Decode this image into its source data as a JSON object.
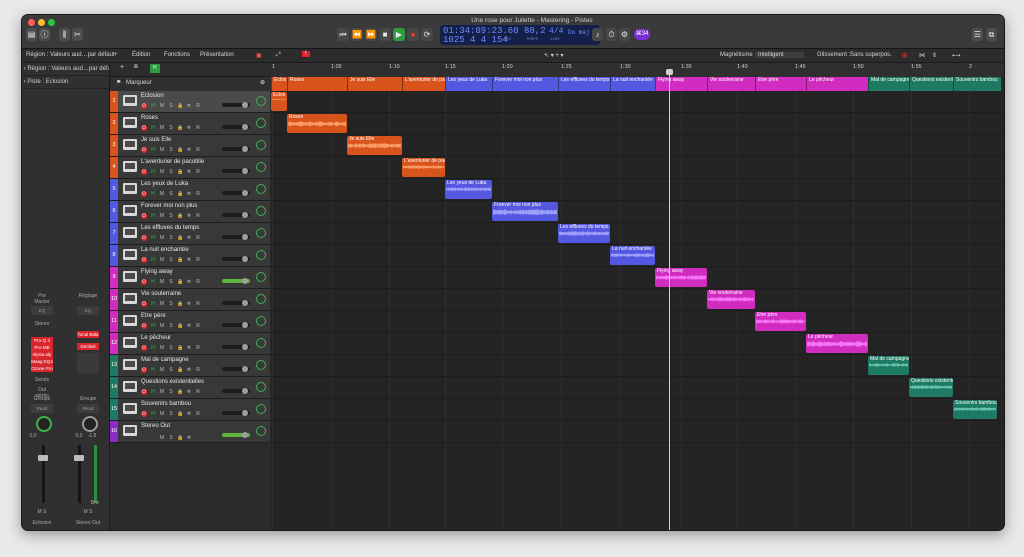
{
  "window": {
    "title": "Une rose pour Juliette - Mastering - Pistes"
  },
  "lcd": {
    "time": "01:34:09:23.60",
    "tempo": "88,2",
    "signature": "4/4",
    "key": "Do maj",
    "bars": "1025  4  4  154",
    "sub_left": "MES",
    "sub_mid": "TEMPO",
    "sub_right": "1490"
  },
  "badge": "⌘34",
  "toolbar": {
    "region_label": "Région : Valeurs aud…par défaut",
    "edition": "Édition",
    "fonctions": "Fonctions",
    "presentation": "Présentation",
    "magnetisme_label": "Magnétisme :",
    "magnetisme_value": "Intelligent",
    "glissement_label": "Glissement :",
    "glissement_value": "Sans superpos."
  },
  "inspector": {
    "piste_label": "Piste : Eclosion",
    "left_strip": {
      "setting": "Pre Master",
      "eq": "EQ",
      "stereo": "Stereo",
      "plugins": [
        "Pro-Q 3",
        "Pro-MB",
        "elysia alp",
        "Maag EQ4",
        "Ozone Pro"
      ],
      "send": "Sends",
      "out": "Out stéréo",
      "group": "Groupe",
      "auto": "Read",
      "vol": "0,0",
      "name": "Eclosion"
    },
    "right_strip": {
      "setting": "Réglage",
      "eq": "EQ",
      "plugins": [
        "Tonal Bala",
        "Decibel"
      ],
      "group": "Groupe",
      "auto": "Read",
      "vol": "0,0",
      "peak": "-1,8",
      "bnc": "Bnc",
      "name": "Stereo Out"
    },
    "ms": "M  S"
  },
  "track_header": {
    "marker_label": "Marqueur",
    "tag": "H"
  },
  "ruler": [
    "1",
    "1:05",
    "1:10",
    "1:15",
    "1:20",
    "1:25",
    "1:30",
    "1:35",
    "1:40",
    "1:45",
    "1:50",
    "1:55",
    "2"
  ],
  "markers": [
    {
      "name": "Eclos",
      "color": "#d9531c"
    },
    {
      "name": "Roses",
      "color": "#d9531c"
    },
    {
      "name": "Je suis Elle",
      "color": "#d9531c"
    },
    {
      "name": "L'aventurier de pacotille",
      "color": "#d9531c"
    },
    {
      "name": "Les yeux de Luka",
      "color": "#5457e0"
    },
    {
      "name": "Forever moi non plus",
      "color": "#5457e0"
    },
    {
      "name": "Les effluves du temps",
      "color": "#5457e0"
    },
    {
      "name": "La nuit enchantée",
      "color": "#5457e0"
    },
    {
      "name": "Flying away",
      "color": "#d12cc0"
    },
    {
      "name": "Vie souterraine",
      "color": "#d12cc0"
    },
    {
      "name": "Etre père",
      "color": "#d12cc0"
    },
    {
      "name": "Le pêcheur",
      "color": "#d12cc0"
    },
    {
      "name": "Mal de campagne",
      "color": "#1e7a63"
    },
    {
      "name": "Questions existentielles",
      "color": "#1e7a63"
    },
    {
      "name": "Souvenirs bambou",
      "color": "#1e7a63"
    }
  ],
  "tracks": [
    {
      "num": "1",
      "name": "Eclosion",
      "color": "#d9531c",
      "region": "Eclos"
    },
    {
      "num": "2",
      "name": "Roses",
      "color": "#d9531c",
      "region": "Roses"
    },
    {
      "num": "3",
      "name": "Je suis Elle",
      "color": "#d9531c",
      "region": "Je suis Elle"
    },
    {
      "num": "4",
      "name": "L'aventurier de pacotille",
      "color": "#d9531c",
      "region": "L'aventurier de pac"
    },
    {
      "num": "5",
      "name": "Les yeux de Luka",
      "color": "#5457e0",
      "region": "Les yeux de Luka"
    },
    {
      "num": "6",
      "name": "Forever moi non plus",
      "color": "#5457e0",
      "region": "Forever moi non plus"
    },
    {
      "num": "7",
      "name": "Les effluves du temps",
      "color": "#5457e0",
      "region": "Les effluves du temps"
    },
    {
      "num": "8",
      "name": "La nuit enchantée",
      "color": "#5457e0",
      "region": "La nuit enchantée"
    },
    {
      "num": "9",
      "name": "Flying away",
      "color": "#d12cc0",
      "region": "Flying away"
    },
    {
      "num": "10",
      "name": "Vie souterraine",
      "color": "#d12cc0",
      "region": "Vie souterraine"
    },
    {
      "num": "11",
      "name": "Etre père",
      "color": "#d12cc0",
      "region": "Etre père"
    },
    {
      "num": "12",
      "name": "Le pêcheur",
      "color": "#d12cc0",
      "region": "Le pêcheur"
    },
    {
      "num": "13",
      "name": "Mal de campagne",
      "color": "#1e7a63",
      "region": "Mal de campagne"
    },
    {
      "num": "14",
      "name": "Questions existentielles",
      "color": "#1e7a63",
      "region": "Questions existentielles"
    },
    {
      "num": "15",
      "name": "Souvenirs bambou",
      "color": "#1e7a63",
      "region": "Souvenirs bambou"
    },
    {
      "num": "16",
      "name": "Stereo Out",
      "color": "#8a2cc4",
      "region": ""
    }
  ],
  "track_buttons": "M S"
}
